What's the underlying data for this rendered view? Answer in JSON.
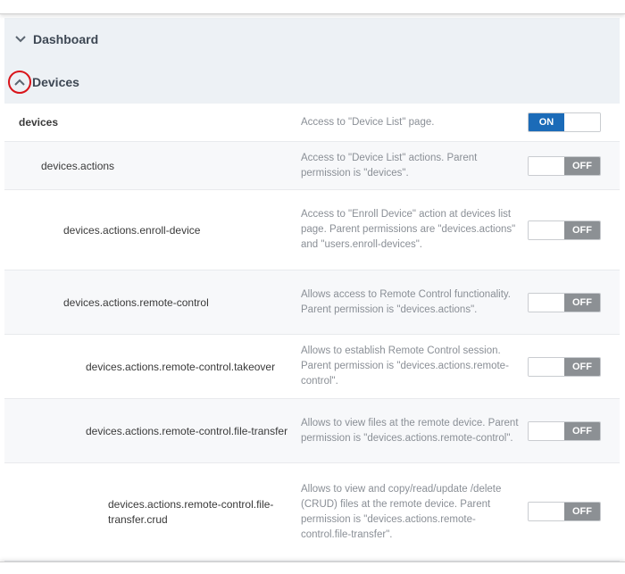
{
  "sections": {
    "dashboard": {
      "label": "Dashboard"
    },
    "devices": {
      "label": "Devices"
    }
  },
  "toggle_labels": {
    "on": "ON",
    "off": "OFF"
  },
  "colors": {
    "toggle_on": "#1b6bb8",
    "toggle_off": "#8c9094",
    "highlight_circle": "#d9141a"
  },
  "permissions": [
    {
      "name": "devices",
      "description": "Access to \"Device List\" page.",
      "state": "ON"
    },
    {
      "name": "devices.actions",
      "description": "Access to \"Device List\" actions. Parent permission is \"devices\".",
      "state": "OFF"
    },
    {
      "name": "devices.actions.enroll-device",
      "description": "Access to \"Enroll Device\" action at devices list page. Parent permissions are \"devices.actions\" and \"users.enroll-devices\".",
      "state": "OFF"
    },
    {
      "name": "devices.actions.remote-control",
      "description": "Allows access to Remote Control functionality. Parent permission is \"devices.actions\".",
      "state": "OFF"
    },
    {
      "name": "devices.actions.remote-control.takeover",
      "description": "Allows to establish Remote Control session. Parent permission is \"devices.actions.remote-control\".",
      "state": "OFF"
    },
    {
      "name": "devices.actions.remote-control.file-transfer",
      "description": "Allows to view files at the remote device. Parent permission is \"devices.actions.remote-control\".",
      "state": "OFF"
    },
    {
      "name": "devices.actions.remote-control.file-transfer.crud",
      "description": "Allows to view and copy/read/update /delete (CRUD) files at the remote device. Parent permission is \"devices.actions.remote-control.file-transfer\".",
      "state": "OFF"
    }
  ]
}
